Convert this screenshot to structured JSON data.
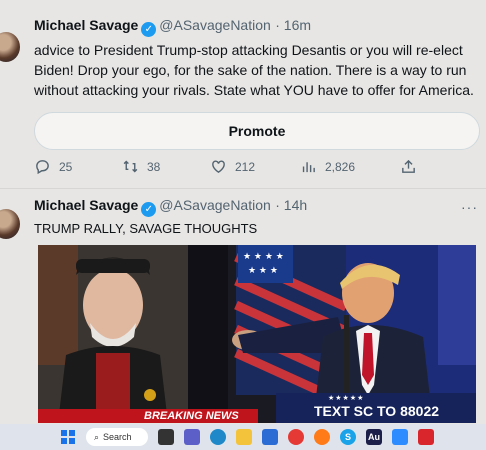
{
  "tweet1": {
    "author": "Michael Savage",
    "handle": "@ASavageNation",
    "time": "· 16m",
    "text_lines": [
      "advice to President Trump-stop attacking Desantis or you will re-elect",
      "Biden! Drop your ego, for the sake of the nation. There is a way to run",
      "without attacking your rivals. State what YOU have to offer for America."
    ],
    "promote_label": "Promote",
    "replies": "25",
    "retweets": "38",
    "likes": "212",
    "views": "2,826"
  },
  "tweet2": {
    "author": "Michael Savage",
    "handle": "@ASavageNation",
    "time": "· 14h",
    "text": "TRUMP RALLY, SAVAGE THOUGHTS",
    "media": {
      "banner_left": "BREAKING NEWS",
      "banner_right": "TEXT SC TO 88022",
      "stars": "★★★★★"
    }
  },
  "taskbar": {
    "search_label": "Search"
  },
  "colors": {
    "verified": "#1d9bf0",
    "secondary_text": "#536471"
  }
}
